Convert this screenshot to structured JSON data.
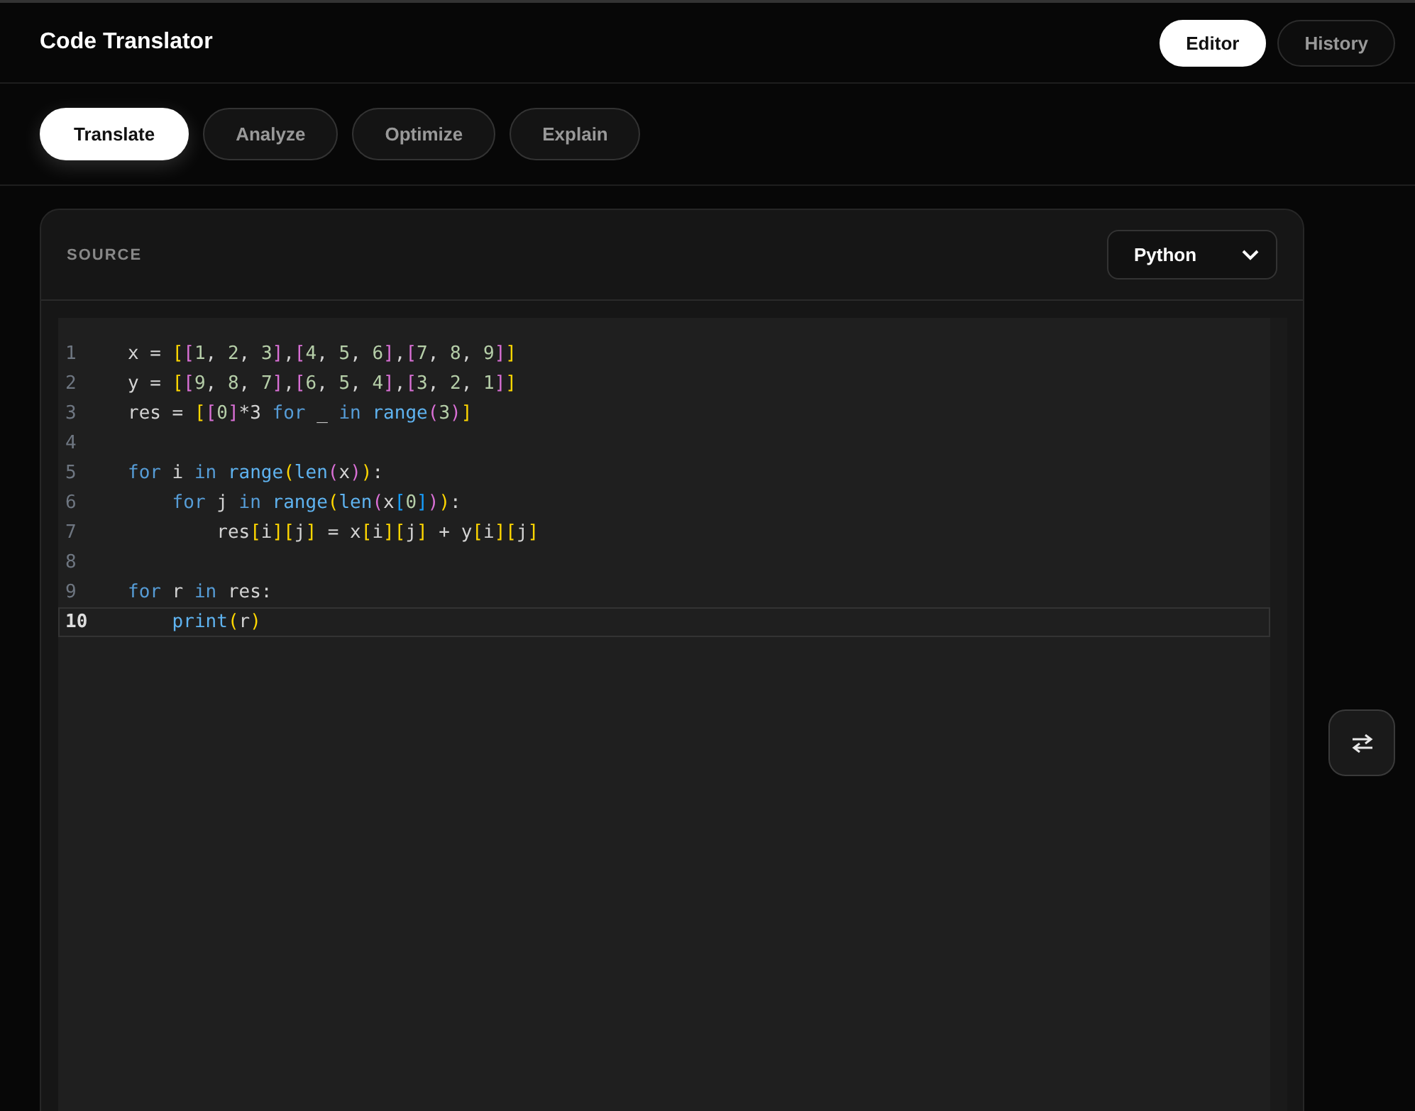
{
  "header": {
    "title": "Code Translator",
    "views": [
      {
        "label": "Editor",
        "selected": true
      },
      {
        "label": "History",
        "selected": false
      }
    ]
  },
  "modes": [
    {
      "label": "Translate",
      "selected": true
    },
    {
      "label": "Analyze",
      "selected": false
    },
    {
      "label": "Optimize",
      "selected": false
    },
    {
      "label": "Explain",
      "selected": false
    }
  ],
  "source_panel": {
    "heading": "SOURCE",
    "language": "Python",
    "lines": [
      {
        "number": "1",
        "current": false,
        "tokens": [
          {
            "text": "x = ",
            "kind": "p"
          },
          {
            "text": "[",
            "kind": "b1"
          },
          {
            "text": "[",
            "kind": "b2"
          },
          {
            "text": "1",
            "kind": "n"
          },
          {
            "text": ", ",
            "kind": "p"
          },
          {
            "text": "2",
            "kind": "n"
          },
          {
            "text": ", ",
            "kind": "p"
          },
          {
            "text": "3",
            "kind": "n"
          },
          {
            "text": "]",
            "kind": "b2"
          },
          {
            "text": ",",
            "kind": "p"
          },
          {
            "text": "[",
            "kind": "b2"
          },
          {
            "text": "4",
            "kind": "n"
          },
          {
            "text": ", ",
            "kind": "p"
          },
          {
            "text": "5",
            "kind": "n"
          },
          {
            "text": ", ",
            "kind": "p"
          },
          {
            "text": "6",
            "kind": "n"
          },
          {
            "text": "]",
            "kind": "b2"
          },
          {
            "text": ",",
            "kind": "p"
          },
          {
            "text": "[",
            "kind": "b2"
          },
          {
            "text": "7",
            "kind": "n"
          },
          {
            "text": ", ",
            "kind": "p"
          },
          {
            "text": "8",
            "kind": "n"
          },
          {
            "text": ", ",
            "kind": "p"
          },
          {
            "text": "9",
            "kind": "n"
          },
          {
            "text": "]",
            "kind": "b2"
          },
          {
            "text": "]",
            "kind": "b1"
          }
        ]
      },
      {
        "number": "2",
        "current": false,
        "tokens": [
          {
            "text": "y = ",
            "kind": "p"
          },
          {
            "text": "[",
            "kind": "b1"
          },
          {
            "text": "[",
            "kind": "b2"
          },
          {
            "text": "9",
            "kind": "n"
          },
          {
            "text": ", ",
            "kind": "p"
          },
          {
            "text": "8",
            "kind": "n"
          },
          {
            "text": ", ",
            "kind": "p"
          },
          {
            "text": "7",
            "kind": "n"
          },
          {
            "text": "]",
            "kind": "b2"
          },
          {
            "text": ",",
            "kind": "p"
          },
          {
            "text": "[",
            "kind": "b2"
          },
          {
            "text": "6",
            "kind": "n"
          },
          {
            "text": ", ",
            "kind": "p"
          },
          {
            "text": "5",
            "kind": "n"
          },
          {
            "text": ", ",
            "kind": "p"
          },
          {
            "text": "4",
            "kind": "n"
          },
          {
            "text": "]",
            "kind": "b2"
          },
          {
            "text": ",",
            "kind": "p"
          },
          {
            "text": "[",
            "kind": "b2"
          },
          {
            "text": "3",
            "kind": "n"
          },
          {
            "text": ", ",
            "kind": "p"
          },
          {
            "text": "2",
            "kind": "n"
          },
          {
            "text": ", ",
            "kind": "p"
          },
          {
            "text": "1",
            "kind": "n"
          },
          {
            "text": "]",
            "kind": "b2"
          },
          {
            "text": "]",
            "kind": "b1"
          }
        ]
      },
      {
        "number": "3",
        "current": false,
        "tokens": [
          {
            "text": "res = ",
            "kind": "p"
          },
          {
            "text": "[",
            "kind": "b1"
          },
          {
            "text": "[",
            "kind": "b2"
          },
          {
            "text": "0",
            "kind": "n"
          },
          {
            "text": "]",
            "kind": "b2"
          },
          {
            "text": "*3 ",
            "kind": "p"
          },
          {
            "text": "for",
            "kind": "k"
          },
          {
            "text": " _ ",
            "kind": "p"
          },
          {
            "text": "in ",
            "kind": "k"
          },
          {
            "text": "range",
            "kind": "f"
          },
          {
            "text": "(",
            "kind": "b2"
          },
          {
            "text": "3",
            "kind": "n"
          },
          {
            "text": ")",
            "kind": "b2"
          },
          {
            "text": "]",
            "kind": "b1"
          }
        ]
      },
      {
        "number": "4",
        "current": false
      },
      {
        "number": "5",
        "current": false,
        "tokens": [
          {
            "text": "for",
            "kind": "k"
          },
          {
            "text": " i ",
            "kind": "p"
          },
          {
            "text": "in ",
            "kind": "k"
          },
          {
            "text": "range",
            "kind": "f"
          },
          {
            "text": "(",
            "kind": "b1"
          },
          {
            "text": "len",
            "kind": "f"
          },
          {
            "text": "(",
            "kind": "b2"
          },
          {
            "text": "x",
            "kind": "p"
          },
          {
            "text": ")",
            "kind": "b2"
          },
          {
            "text": ")",
            "kind": "b1"
          },
          {
            "text": ":",
            "kind": "p"
          }
        ]
      },
      {
        "number": "6",
        "current": false,
        "tokens": [
          {
            "text": "    for",
            "kind": "k"
          },
          {
            "text": " j ",
            "kind": "p"
          },
          {
            "text": "in ",
            "kind": "k"
          },
          {
            "text": "range",
            "kind": "f"
          },
          {
            "text": "(",
            "kind": "b1"
          },
          {
            "text": "len",
            "kind": "f"
          },
          {
            "text": "(",
            "kind": "b2"
          },
          {
            "text": "x",
            "kind": "p"
          },
          {
            "text": "[",
            "kind": "b3"
          },
          {
            "text": "0",
            "kind": "n"
          },
          {
            "text": "]",
            "kind": "b3"
          },
          {
            "text": ")",
            "kind": "b2"
          },
          {
            "text": ")",
            "kind": "b1"
          },
          {
            "text": ":",
            "kind": "p"
          }
        ]
      },
      {
        "number": "7",
        "current": false,
        "tokens": [
          {
            "text": "        res",
            "kind": "p"
          },
          {
            "text": "[",
            "kind": "b1"
          },
          {
            "text": "i",
            "kind": "p"
          },
          {
            "text": "]",
            "kind": "b1"
          },
          {
            "text": "[",
            "kind": "b1"
          },
          {
            "text": "j",
            "kind": "p"
          },
          {
            "text": "]",
            "kind": "b1"
          },
          {
            "text": " = x",
            "kind": "p"
          },
          {
            "text": "[",
            "kind": "b1"
          },
          {
            "text": "i",
            "kind": "p"
          },
          {
            "text": "]",
            "kind": "b1"
          },
          {
            "text": "[",
            "kind": "b1"
          },
          {
            "text": "j",
            "kind": "p"
          },
          {
            "text": "]",
            "kind": "b1"
          },
          {
            "text": " + y",
            "kind": "p"
          },
          {
            "text": "[",
            "kind": "b1"
          },
          {
            "text": "i",
            "kind": "p"
          },
          {
            "text": "]",
            "kind": "b1"
          },
          {
            "text": "[",
            "kind": "b1"
          },
          {
            "text": "j",
            "kind": "p"
          },
          {
            "text": "]",
            "kind": "b1"
          }
        ]
      },
      {
        "number": "8",
        "current": false
      },
      {
        "number": "9",
        "current": false,
        "tokens": [
          {
            "text": "for",
            "kind": "k"
          },
          {
            "text": " r ",
            "kind": "p"
          },
          {
            "text": "in",
            "kind": "k"
          },
          {
            "text": " res:",
            "kind": "p"
          }
        ]
      },
      {
        "number": "10",
        "current": true,
        "tokens": [
          {
            "text": "    print",
            "kind": "f"
          },
          {
            "text": "(",
            "kind": "b1"
          },
          {
            "text": "r",
            "kind": "p"
          },
          {
            "text": ")",
            "kind": "b1"
          }
        ]
      }
    ]
  }
}
